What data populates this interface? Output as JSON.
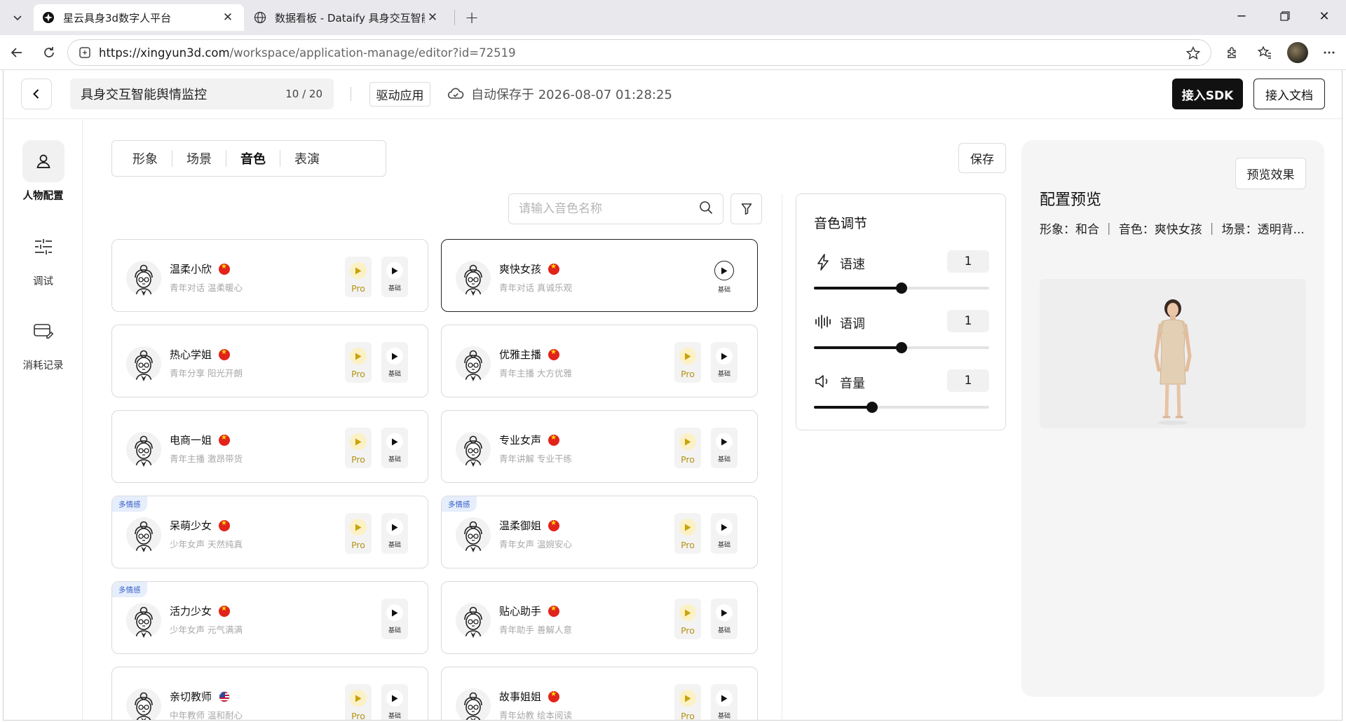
{
  "browser": {
    "tabs": [
      {
        "title": "星云具身3d数字人平台",
        "active": true
      },
      {
        "title": "数据看板 - Dataify 具身交互智能舆",
        "active": false
      }
    ],
    "url_host": "https://xingyun3d.com",
    "url_path": "/workspace/application-manage/editor?id=72519"
  },
  "header": {
    "app_name": "具身交互智能舆情监控",
    "name_count": "10 / 20",
    "drive_label": "驱动应用",
    "autosave_text": "自动保存于 2026-08-07 01:28:25",
    "sdk_label": "接入SDK",
    "doc_label": "接入文档"
  },
  "rail": {
    "items": [
      {
        "label": "人物配置",
        "icon": "person-icon",
        "active": true
      },
      {
        "label": "调试",
        "icon": "sliders-icon",
        "active": false
      },
      {
        "label": "消耗记录",
        "icon": "card-icon",
        "active": false
      }
    ]
  },
  "tabs": [
    {
      "label": "形象",
      "active": false
    },
    {
      "label": "场景",
      "active": false
    },
    {
      "label": "音色",
      "active": true
    },
    {
      "label": "表演",
      "active": false
    }
  ],
  "save_label": "保存",
  "search": {
    "placeholder": "请输入音色名称"
  },
  "labels": {
    "pro": "Pro",
    "basic": "基础",
    "badge": "多情感"
  },
  "voices": [
    {
      "name": "温柔小欣",
      "desc": "青年对话 温柔暖心",
      "flag": "cn",
      "badge": false,
      "pro": true,
      "selected": false
    },
    {
      "name": "爽快女孩",
      "desc": "青年对话 真诚乐观",
      "flag": "cn",
      "badge": false,
      "pro": false,
      "selected": true
    },
    {
      "name": "热心学姐",
      "desc": "青年分享 阳光开朗",
      "flag": "cn",
      "badge": false,
      "pro": true,
      "selected": false
    },
    {
      "name": "优雅主播",
      "desc": "青年主播 大方优雅",
      "flag": "cn",
      "badge": false,
      "pro": true,
      "selected": false
    },
    {
      "name": "电商一姐",
      "desc": "青年主播 激昂带货",
      "flag": "cn",
      "badge": false,
      "pro": true,
      "selected": false
    },
    {
      "name": "专业女声",
      "desc": "青年讲解 专业干练",
      "flag": "cn",
      "badge": false,
      "pro": true,
      "selected": false
    },
    {
      "name": "呆萌少女",
      "desc": "少年女声 天然纯真",
      "flag": "cn",
      "badge": true,
      "pro": true,
      "selected": false
    },
    {
      "name": "温柔御姐",
      "desc": "青年女声 温婉安心",
      "flag": "cn",
      "badge": true,
      "pro": true,
      "selected": false
    },
    {
      "name": "活力少女",
      "desc": "少年女声 元气满满",
      "flag": "cn",
      "badge": true,
      "pro": false,
      "selected": false
    },
    {
      "name": "贴心助手",
      "desc": "青年助手 善解人意",
      "flag": "cn",
      "badge": false,
      "pro": true,
      "selected": false
    },
    {
      "name": "亲切教师",
      "desc": "中年教师 温和耐心",
      "flag": "us",
      "badge": false,
      "pro": true,
      "selected": false
    },
    {
      "name": "故事姐姐",
      "desc": "青年幼教 绘本阅读",
      "flag": "cn",
      "badge": false,
      "pro": true,
      "selected": false
    }
  ],
  "adjust": {
    "title": "音色调节",
    "rows": [
      {
        "label": "语速",
        "value": "1",
        "level": 0.5,
        "icon": "bolt-icon"
      },
      {
        "label": "语调",
        "value": "1",
        "level": 0.5,
        "icon": "waveform-icon"
      },
      {
        "label": "音量",
        "value": "1",
        "level": 0.33,
        "icon": "speaker-icon"
      }
    ]
  },
  "preview": {
    "button": "预览效果",
    "title": "配置预览",
    "meta": "形象：和合 ｜ 音色：爽快女孩 ｜ 场景：透明背..."
  }
}
